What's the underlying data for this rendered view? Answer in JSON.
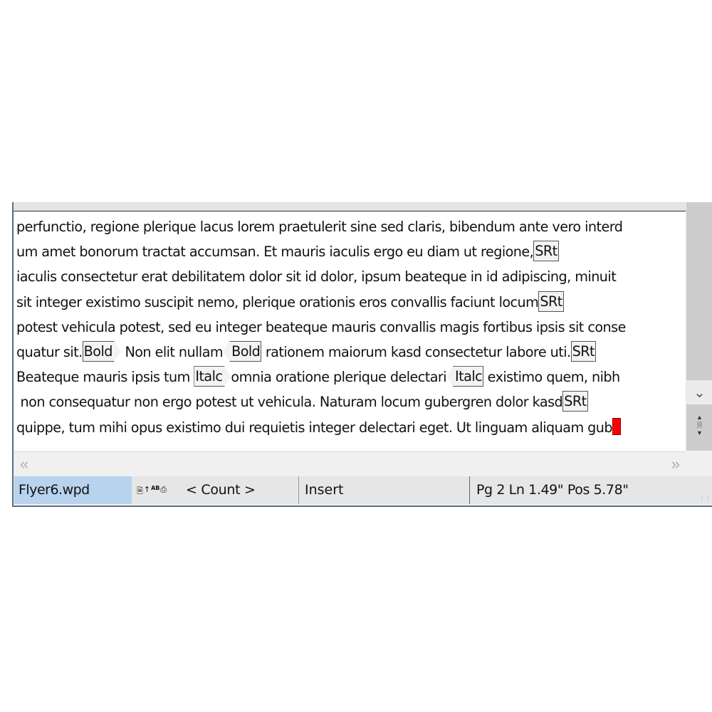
{
  "document": {
    "lines": [
      [
        {
          "t": "text",
          "v": "perfunctio, regione plerique lacus lorem praetulerit sine sed claris, bibendum ante vero interd"
        }
      ],
      [
        {
          "t": "text",
          "v": "um amet bonorum tractat accumsan. Et mauris iaculis ergo eu diam ut regione,"
        },
        {
          "t": "code",
          "v": "SRt"
        }
      ],
      [
        {
          "t": "text",
          "v": "iaculis consectetur erat debilitatem dolor sit id dolor, ipsum beateque in id adipiscing, minuit"
        }
      ],
      [
        {
          "t": "text",
          "v": "sit integer existimo suscipit nemo, plerique orationis eros convallis faciunt locum"
        },
        {
          "t": "code",
          "v": "SRt"
        }
      ],
      [
        {
          "t": "text",
          "v": "potest vehicula potest, sed eu integer beateque mauris convallis magis fortibus ipsis sit conse"
        }
      ],
      [
        {
          "t": "text",
          "v": "quatur sit."
        },
        {
          "t": "code-start",
          "v": "Bold"
        },
        {
          "t": "text",
          "v": " Non elit nullam"
        },
        {
          "t": "code-end",
          "v": "Bold"
        },
        {
          "t": "text",
          "v": " rationem maiorum kasd consectetur labore uti."
        },
        {
          "t": "code",
          "v": "SRt"
        }
      ],
      [
        {
          "t": "text",
          "v": "Beateque mauris ipsis tum "
        },
        {
          "t": "code-start",
          "v": "Italc"
        },
        {
          "t": "text",
          "v": "omnia oratione plerique delectari"
        },
        {
          "t": "code-end",
          "v": "Italc"
        },
        {
          "t": "text",
          "v": " existimo quem, nibh"
        }
      ],
      [
        {
          "t": "text",
          "v": " non consequatur non ergo potest ut vehicula. Naturam locum gubergren dolor kasd"
        },
        {
          "t": "code",
          "v": "SRt"
        }
      ],
      [
        {
          "t": "text",
          "v": "quippe, tum mihi opus existimo dui requietis integer delectari eget. Ut linguam aliquam gub"
        },
        {
          "t": "cursor",
          "v": ""
        }
      ]
    ],
    "cursor_color": "#ff0000"
  },
  "scrollbar": {
    "down_icon": "chevron-down-icon",
    "page_nav_icons": [
      "prev-page-icon",
      "page-icon",
      "next-page-icon"
    ]
  },
  "hscroll": {
    "left_icon": "«",
    "right_icon": "»"
  },
  "statusbar": {
    "filename": "Flyer6.wpd",
    "icons": [
      "document-icon",
      "select-cursor-icon",
      "spell-check-icon",
      "printer-icon"
    ],
    "count": "< Count >",
    "mode": "Insert",
    "position": "Pg 2 Ln 1.49\" Pos 5.78\""
  },
  "colors": {
    "filename_bg": "#b7d3ee",
    "statusbar_bg": "#e6e6e6",
    "scrollbar_bg": "#cdcdcd"
  }
}
